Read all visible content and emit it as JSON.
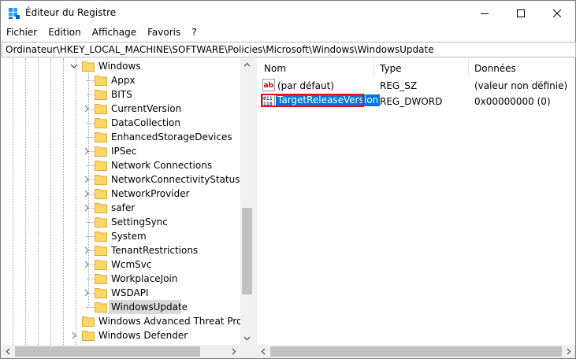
{
  "window": {
    "title": "Éditeur du Registre",
    "buttons": {
      "minimize": "minimize-icon",
      "maximize": "maximize-icon",
      "close": "close-icon"
    }
  },
  "menu": [
    "Fichier",
    "Edition",
    "Affichage",
    "Favoris",
    "?"
  ],
  "address": "Ordinateur\\HKEY_LOCAL_MACHINE\\SOFTWARE\\Policies\\Microsoft\\Windows\\WindowsUpdate",
  "tree": {
    "parent": {
      "label": "Windows",
      "expanded": true
    },
    "children": [
      {
        "label": "Appx",
        "expandable": false
      },
      {
        "label": "BITS",
        "expandable": false
      },
      {
        "label": "CurrentVersion",
        "expandable": true
      },
      {
        "label": "DataCollection",
        "expandable": false
      },
      {
        "label": "EnhancedStorageDevices",
        "expandable": false
      },
      {
        "label": "IPSec",
        "expandable": true
      },
      {
        "label": "Network Connections",
        "expandable": false
      },
      {
        "label": "NetworkConnectivityStatusIndi",
        "expandable": true
      },
      {
        "label": "NetworkProvider",
        "expandable": true
      },
      {
        "label": "safer",
        "expandable": true
      },
      {
        "label": "SettingSync",
        "expandable": false
      },
      {
        "label": "System",
        "expandable": false
      },
      {
        "label": "TenantRestrictions",
        "expandable": true
      },
      {
        "label": "WcmSvc",
        "expandable": true
      },
      {
        "label": "WorkplaceJoin",
        "expandable": false
      },
      {
        "label": "WSDAPI",
        "expandable": true
      },
      {
        "label": "WindowsUpdate",
        "expandable": false,
        "selected": true
      }
    ],
    "siblings": [
      {
        "label": "Windows Advanced Threat Protect",
        "expandable": false
      },
      {
        "label": "Windows Defender",
        "expandable": true
      }
    ]
  },
  "list": {
    "columns": [
      "Nom",
      "Type",
      "Données"
    ],
    "rows": [
      {
        "name": "(par défaut)",
        "type": "REG_SZ",
        "data": "(valeur non définie)",
        "icon": "string-value-icon"
      },
      {
        "name": "TargetReleaseVersion",
        "type": "REG_DWORD",
        "data": "0x00000000 (0)",
        "icon": "dword-value-icon",
        "selected": true
      }
    ]
  },
  "colors": {
    "selection": "#0078d7",
    "highlight_border": "#e0101c",
    "folder": "#ffd766"
  }
}
